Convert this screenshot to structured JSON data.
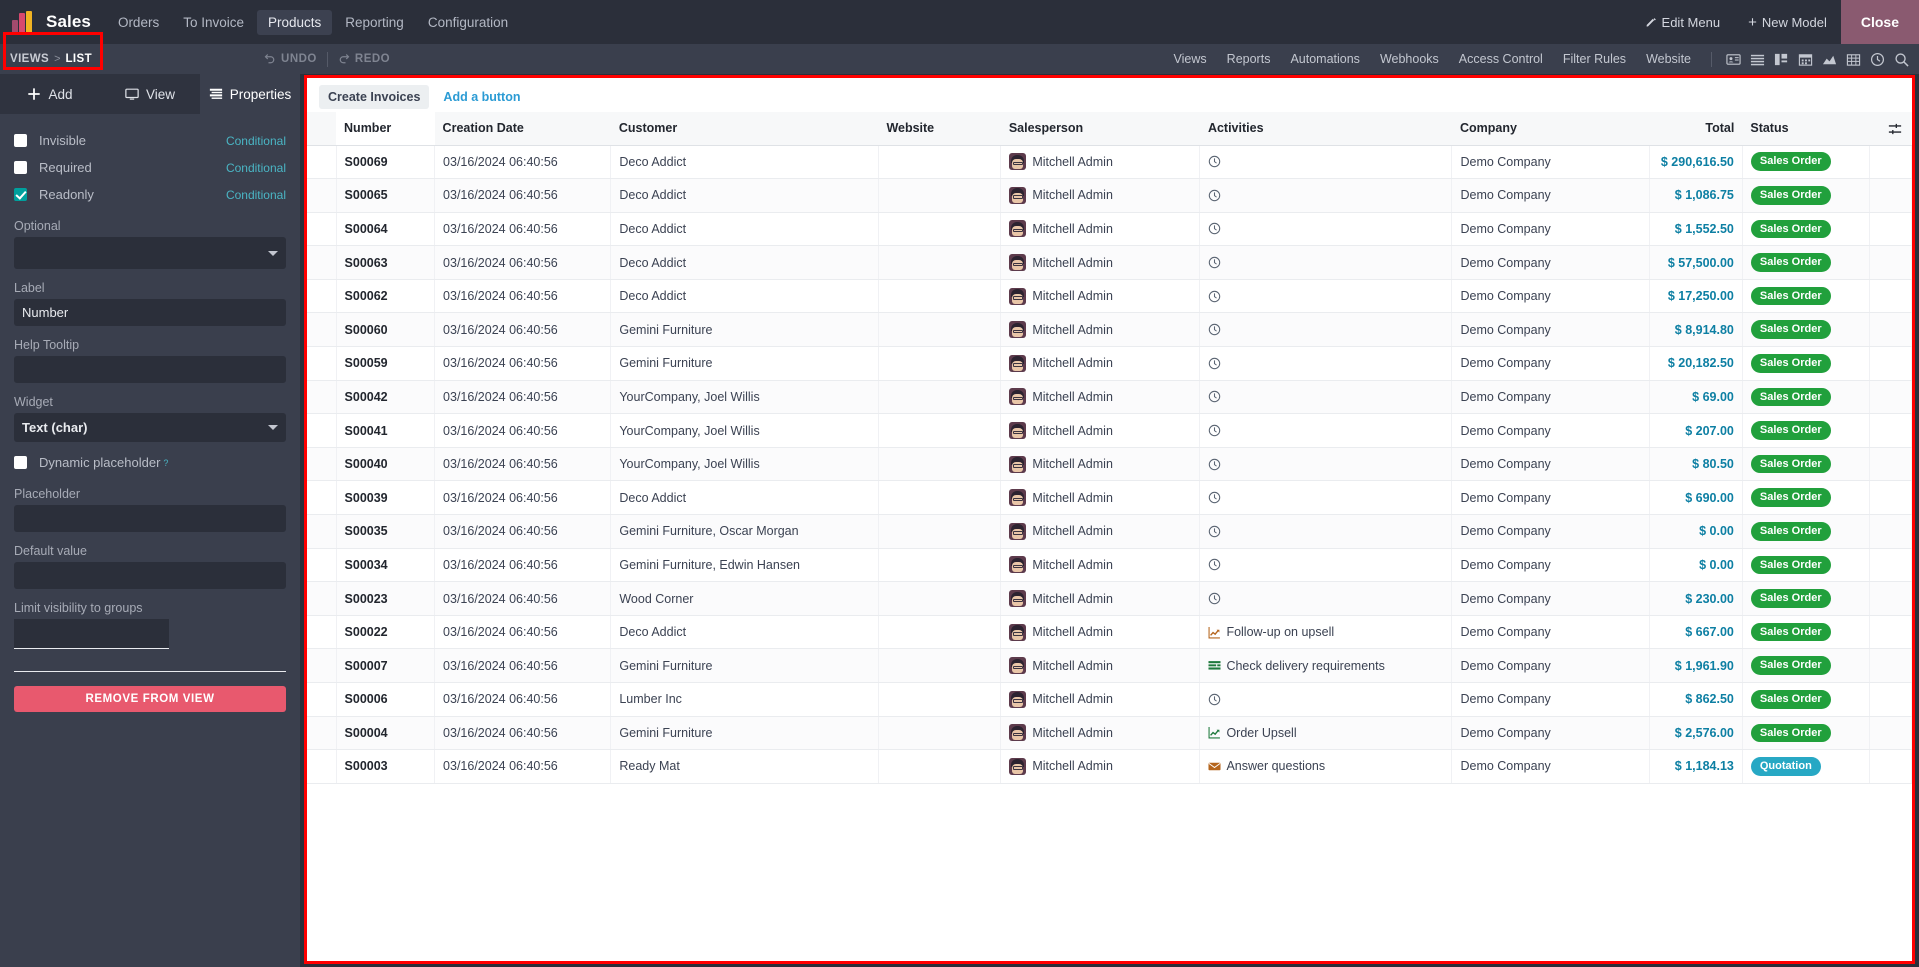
{
  "topbar": {
    "app_name": "Sales",
    "logo": "odoo-bars-logo",
    "menus": [
      {
        "label": "Orders",
        "active": false
      },
      {
        "label": "To Invoice",
        "active": false
      },
      {
        "label": "Products",
        "active": true
      },
      {
        "label": "Reporting",
        "active": false
      },
      {
        "label": "Configuration",
        "active": false
      }
    ],
    "edit_menu": "Edit Menu",
    "new_model": "New Model",
    "close": "Close"
  },
  "subbar": {
    "breadcrumb_root": "VIEWS",
    "breadcrumb_sep": ">",
    "breadcrumb_current": "LIST",
    "undo": "UNDO",
    "redo": "REDO",
    "links": [
      "Views",
      "Reports",
      "Automations",
      "Webhooks",
      "Access Control",
      "Filter Rules",
      "Website"
    ],
    "view_icons": [
      "contact-card-icon",
      "list-icon",
      "kanban-icon",
      "calendar-icon",
      "graph-icon",
      "pivot-icon",
      "activity-clock-icon",
      "search-icon"
    ]
  },
  "sidebar": {
    "tabs": [
      {
        "label": "Add",
        "icon": "plus-icon",
        "active": false
      },
      {
        "label": "View",
        "icon": "monitor-icon",
        "active": false
      },
      {
        "label": "Properties",
        "icon": "properties-icon",
        "active": true
      }
    ],
    "checkboxes": [
      {
        "label": "Invisible",
        "checked": false,
        "conditional": "Conditional"
      },
      {
        "label": "Required",
        "checked": false,
        "conditional": "Conditional"
      },
      {
        "label": "Readonly",
        "checked": true,
        "conditional": "Conditional"
      }
    ],
    "optional_label": "Optional",
    "optional_value": "",
    "label_label": "Label",
    "label_value": "Number",
    "help_tooltip_label": "Help Tooltip",
    "help_tooltip_value": "",
    "widget_label": "Widget",
    "widget_value": "Text (char)",
    "dynamic_placeholder_label": "Dynamic placeholder",
    "dynamic_placeholder_help": "?",
    "dynamic_placeholder_checked": false,
    "placeholder_label": "Placeholder",
    "placeholder_value": "",
    "default_value_label": "Default value",
    "default_value_value": "",
    "limit_groups_label": "Limit visibility to groups",
    "limit_groups_value": "",
    "remove_button": "REMOVE FROM VIEW"
  },
  "main": {
    "create_invoices": "Create Invoices",
    "add_a_button": "Add a button",
    "optional_columns_icon": "column-options-icon",
    "columns": [
      "Number",
      "Creation Date",
      "Customer",
      "Website",
      "Salesperson",
      "Activities",
      "Company",
      "Total",
      "Status"
    ],
    "selected_column": "Number",
    "rows": [
      {
        "number": "S00069",
        "creation_date": "03/16/2024 06:40:56",
        "customer": "Deco Addict",
        "website": "",
        "salesperson": "Mitchell Admin",
        "activity": "",
        "activity_icon": "clock-icon",
        "company": "Demo Company",
        "total": "$ 290,616.50",
        "status": "Sales Order",
        "status_type": "so"
      },
      {
        "number": "S00065",
        "creation_date": "03/16/2024 06:40:56",
        "customer": "Deco Addict",
        "website": "",
        "salesperson": "Mitchell Admin",
        "activity": "",
        "activity_icon": "clock-icon",
        "company": "Demo Company",
        "total": "$ 1,086.75",
        "status": "Sales Order",
        "status_type": "so"
      },
      {
        "number": "S00064",
        "creation_date": "03/16/2024 06:40:56",
        "customer": "Deco Addict",
        "website": "",
        "salesperson": "Mitchell Admin",
        "activity": "",
        "activity_icon": "clock-icon",
        "company": "Demo Company",
        "total": "$ 1,552.50",
        "status": "Sales Order",
        "status_type": "so"
      },
      {
        "number": "S00063",
        "creation_date": "03/16/2024 06:40:56",
        "customer": "Deco Addict",
        "website": "",
        "salesperson": "Mitchell Admin",
        "activity": "",
        "activity_icon": "clock-icon",
        "company": "Demo Company",
        "total": "$ 57,500.00",
        "status": "Sales Order",
        "status_type": "so"
      },
      {
        "number": "S00062",
        "creation_date": "03/16/2024 06:40:56",
        "customer": "Deco Addict",
        "website": "",
        "salesperson": "Mitchell Admin",
        "activity": "",
        "activity_icon": "clock-icon",
        "company": "Demo Company",
        "total": "$ 17,250.00",
        "status": "Sales Order",
        "status_type": "so"
      },
      {
        "number": "S00060",
        "creation_date": "03/16/2024 06:40:56",
        "customer": "Gemini Furniture",
        "website": "",
        "salesperson": "Mitchell Admin",
        "activity": "",
        "activity_icon": "clock-icon",
        "company": "Demo Company",
        "total": "$ 8,914.80",
        "status": "Sales Order",
        "status_type": "so"
      },
      {
        "number": "S00059",
        "creation_date": "03/16/2024 06:40:56",
        "customer": "Gemini Furniture",
        "website": "",
        "salesperson": "Mitchell Admin",
        "activity": "",
        "activity_icon": "clock-icon",
        "company": "Demo Company",
        "total": "$ 20,182.50",
        "status": "Sales Order",
        "status_type": "so"
      },
      {
        "number": "S00042",
        "creation_date": "03/16/2024 06:40:56",
        "customer": "YourCompany, Joel Willis",
        "website": "",
        "salesperson": "Mitchell Admin",
        "activity": "",
        "activity_icon": "clock-icon",
        "company": "Demo Company",
        "total": "$ 69.00",
        "status": "Sales Order",
        "status_type": "so"
      },
      {
        "number": "S00041",
        "creation_date": "03/16/2024 06:40:56",
        "customer": "YourCompany, Joel Willis",
        "website": "",
        "salesperson": "Mitchell Admin",
        "activity": "",
        "activity_icon": "clock-icon",
        "company": "Demo Company",
        "total": "$ 207.00",
        "status": "Sales Order",
        "status_type": "so"
      },
      {
        "number": "S00040",
        "creation_date": "03/16/2024 06:40:56",
        "customer": "YourCompany, Joel Willis",
        "website": "",
        "salesperson": "Mitchell Admin",
        "activity": "",
        "activity_icon": "clock-icon",
        "company": "Demo Company",
        "total": "$ 80.50",
        "status": "Sales Order",
        "status_type": "so"
      },
      {
        "number": "S00039",
        "creation_date": "03/16/2024 06:40:56",
        "customer": "Deco Addict",
        "website": "",
        "salesperson": "Mitchell Admin",
        "activity": "",
        "activity_icon": "clock-icon",
        "company": "Demo Company",
        "total": "$ 690.00",
        "status": "Sales Order",
        "status_type": "so"
      },
      {
        "number": "S00035",
        "creation_date": "03/16/2024 06:40:56",
        "customer": "Gemini Furniture, Oscar Morgan",
        "website": "",
        "salesperson": "Mitchell Admin",
        "activity": "",
        "activity_icon": "clock-icon",
        "company": "Demo Company",
        "total": "$ 0.00",
        "status": "Sales Order",
        "status_type": "so"
      },
      {
        "number": "S00034",
        "creation_date": "03/16/2024 06:40:56",
        "customer": "Gemini Furniture, Edwin Hansen",
        "website": "",
        "salesperson": "Mitchell Admin",
        "activity": "",
        "activity_icon": "clock-icon",
        "company": "Demo Company",
        "total": "$ 0.00",
        "status": "Sales Order",
        "status_type": "so"
      },
      {
        "number": "S00023",
        "creation_date": "03/16/2024 06:40:56",
        "customer": "Wood Corner",
        "website": "",
        "salesperson": "Mitchell Admin",
        "activity": "",
        "activity_icon": "clock-icon",
        "company": "Demo Company",
        "total": "$ 230.00",
        "status": "Sales Order",
        "status_type": "so"
      },
      {
        "number": "S00022",
        "creation_date": "03/16/2024 06:40:56",
        "customer": "Deco Addict",
        "website": "",
        "salesperson": "Mitchell Admin",
        "activity": "Follow-up on upsell",
        "activity_icon": "chart-up-orange-icon",
        "company": "Demo Company",
        "total": "$ 667.00",
        "status": "Sales Order",
        "status_type": "so"
      },
      {
        "number": "S00007",
        "creation_date": "03/16/2024 06:40:56",
        "customer": "Gemini Furniture",
        "website": "",
        "salesperson": "Mitchell Admin",
        "activity": "Check delivery requirements",
        "activity_icon": "list-green-icon",
        "company": "Demo Company",
        "total": "$ 1,961.90",
        "status": "Sales Order",
        "status_type": "so"
      },
      {
        "number": "S00006",
        "creation_date": "03/16/2024 06:40:56",
        "customer": "Lumber Inc",
        "website": "",
        "salesperson": "Mitchell Admin",
        "activity": "",
        "activity_icon": "clock-icon",
        "company": "Demo Company",
        "total": "$ 862.50",
        "status": "Sales Order",
        "status_type": "so"
      },
      {
        "number": "S00004",
        "creation_date": "03/16/2024 06:40:56",
        "customer": "Gemini Furniture",
        "website": "",
        "salesperson": "Mitchell Admin",
        "activity": "Order Upsell",
        "activity_icon": "chart-up-green-icon",
        "company": "Demo Company",
        "total": "$ 2,576.00",
        "status": "Sales Order",
        "status_type": "so"
      },
      {
        "number": "S00003",
        "creation_date": "03/16/2024 06:40:56",
        "customer": "Ready Mat",
        "website": "",
        "salesperson": "Mitchell Admin",
        "activity": "Answer questions",
        "activity_icon": "envelope-orange-icon",
        "company": "Demo Company",
        "total": "$ 1,184.13",
        "status": "Quotation",
        "status_type": "qt"
      }
    ]
  },
  "colors": {
    "accent_teal": "#00a09d",
    "status_sales_order": "#21a03c",
    "status_quotation": "#27a8c4",
    "total_text": "#0d7fa3",
    "remove_button": "#e8596e",
    "highlight_outline": "#ff0000",
    "link_blue": "#2b9bd4"
  }
}
